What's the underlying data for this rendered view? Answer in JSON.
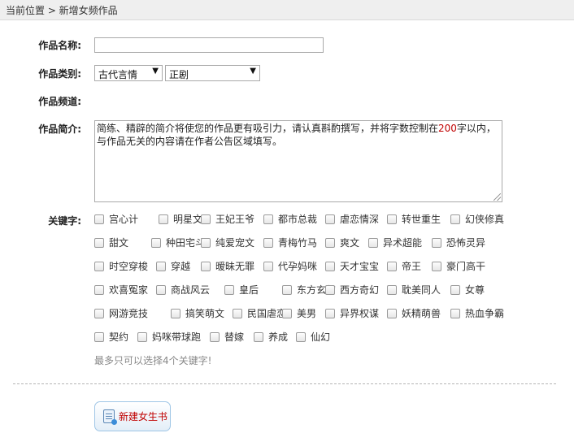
{
  "breadcrumb": {
    "text": "当前位置 > 新增女频作品"
  },
  "form": {
    "name_label": "作品名称:",
    "name_value": "",
    "category_label": "作品类别:",
    "category_select_1": "古代言情",
    "category_select_2": "正剧",
    "channel_label": "作品频道:",
    "channel_value": "",
    "intro_label": "作品简介:",
    "intro_text_1": "简练、精辟的简介将使您的作品更有吸引力，请认真斟酌撰写，并将字数控制在",
    "intro_text_num": "200",
    "intro_text_2": "字以内，",
    "intro_text_3": "与作品无关的内容请在作者公告区域填写。",
    "keywords_label": "关键字:",
    "keywords_rows": [
      [
        "宫心计",
        "明星文",
        "王妃王爷",
        "都市总裁",
        "虐恋情深",
        "转世重生",
        "幻侠修真"
      ],
      [
        "甜文",
        "种田宅斗",
        "纯爱宠文",
        "青梅竹马",
        "爽文",
        "异术超能",
        "恐怖灵异"
      ],
      [
        "时空穿梭",
        "穿越",
        "暧昧无罪",
        "代孕妈咪",
        "天才宝宝",
        "帝王",
        "豪门高干"
      ],
      [
        "欢喜冤家",
        "商战风云",
        "皇后",
        "东方玄幻",
        "西方奇幻",
        "耽美同人",
        "女尊"
      ],
      [
        "网游竞技",
        "搞笑萌文",
        "民国虐恋",
        "美男",
        "异界权谋",
        "妖精萌兽",
        "热血争霸"
      ],
      [
        "契约",
        "妈咪带球跑",
        "替嫁",
        "养成",
        "仙幻"
      ]
    ],
    "keywords_hint": "最多只可以选择4个关键字!"
  },
  "actions": {
    "create_label": "新建女生书"
  }
}
